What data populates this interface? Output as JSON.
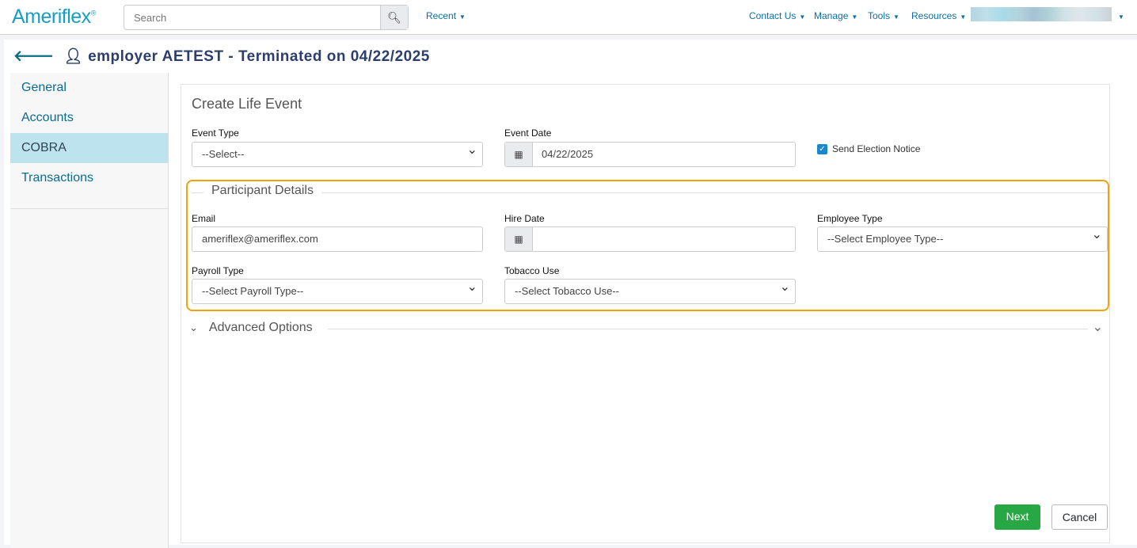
{
  "header": {
    "logo": "Ameriflex",
    "search_placeholder": "Search",
    "recent": "Recent",
    "nav": [
      "Contact Us",
      "Manage",
      "Tools",
      "Resources"
    ]
  },
  "page": {
    "title": "employer AETEST - Terminated on 04/22/2025"
  },
  "sidebar": {
    "items": [
      "General",
      "Accounts",
      "COBRA",
      "Transactions"
    ]
  },
  "form": {
    "heading": "Create Life Event",
    "event_type_label": "Event Type",
    "event_type_value": "--Select--",
    "event_date_label": "Event Date",
    "event_date_value": "04/22/2025",
    "send_notice_label": "Send Election Notice",
    "participant_legend": "Participant Details",
    "email_label": "Email",
    "email_value": "ameriflex@ameriflex.com",
    "hire_date_label": "Hire Date",
    "hire_date_value": "",
    "employee_type_label": "Employee Type",
    "employee_type_value": "--Select Employee Type--",
    "payroll_type_label": "Payroll Type",
    "payroll_type_value": "--Select Payroll Type--",
    "tobacco_label": "Tobacco Use",
    "tobacco_value": "--Select Tobacco Use--",
    "advanced": "Advanced Options",
    "next": "Next",
    "cancel": "Cancel"
  }
}
